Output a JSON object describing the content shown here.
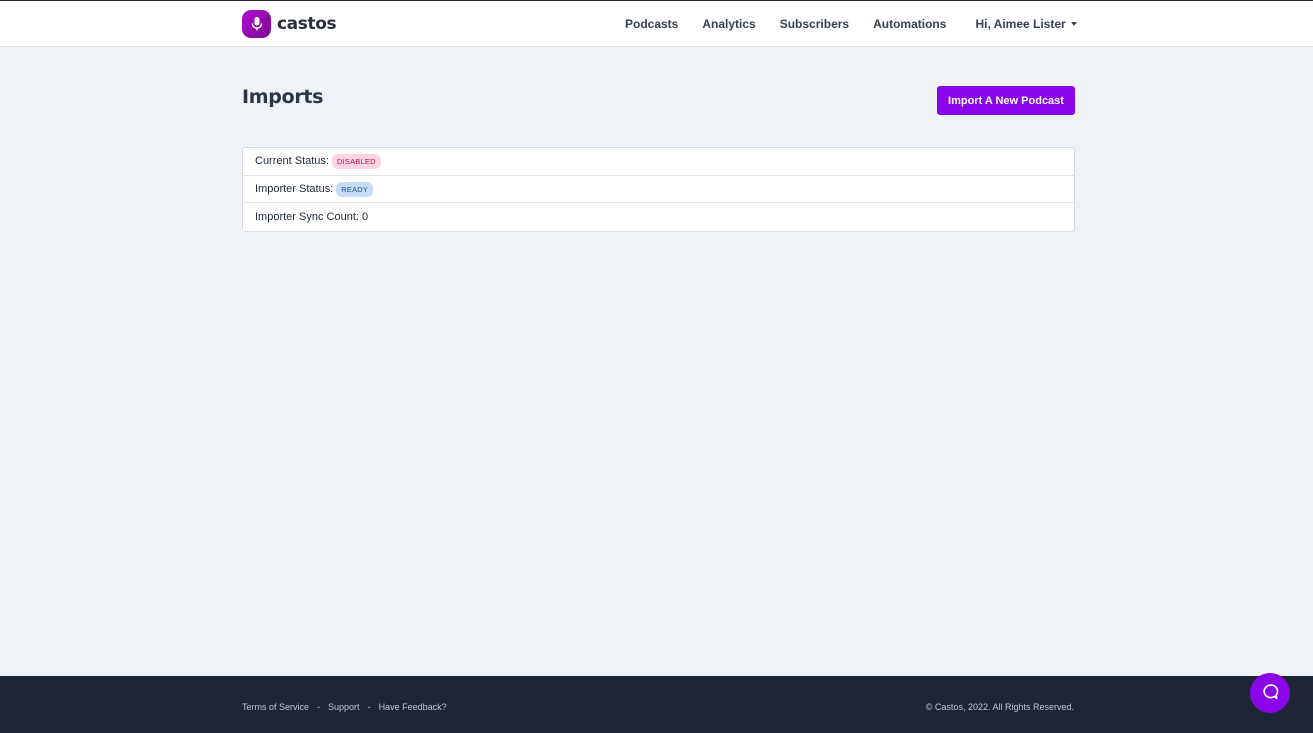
{
  "brand": {
    "name": "castos",
    "icon": "microphone-icon",
    "color": "#8a05e8"
  },
  "nav": {
    "items": [
      {
        "label": "Podcasts"
      },
      {
        "label": "Analytics"
      },
      {
        "label": "Subscribers"
      },
      {
        "label": "Automations"
      }
    ],
    "user_label": "Hi, Aimee Lister",
    "user_icon": "caret-down-icon"
  },
  "page": {
    "title": "Imports",
    "import_button": "Import A New Podcast"
  },
  "status": {
    "current_status_label": "Current Status:",
    "current_status_value": "DISABLED",
    "importer_status_label": "Importer Status:",
    "importer_status_value": "READY",
    "sync_count_label": "Importer Sync Count: 0"
  },
  "badge_colors": {
    "disabled_bg": "#fbd3e2",
    "disabled_text": "#b31452",
    "ready_bg": "#c5dcf7",
    "ready_text": "#1e4f8e"
  },
  "footer": {
    "links": [
      "Terms of Service",
      "Support",
      "Have Feedback?"
    ],
    "separator": "-",
    "copyright": "© Castos, 2022. All Rights Reserved."
  },
  "help_widget": {
    "icon": "chat-bubble-icon"
  }
}
